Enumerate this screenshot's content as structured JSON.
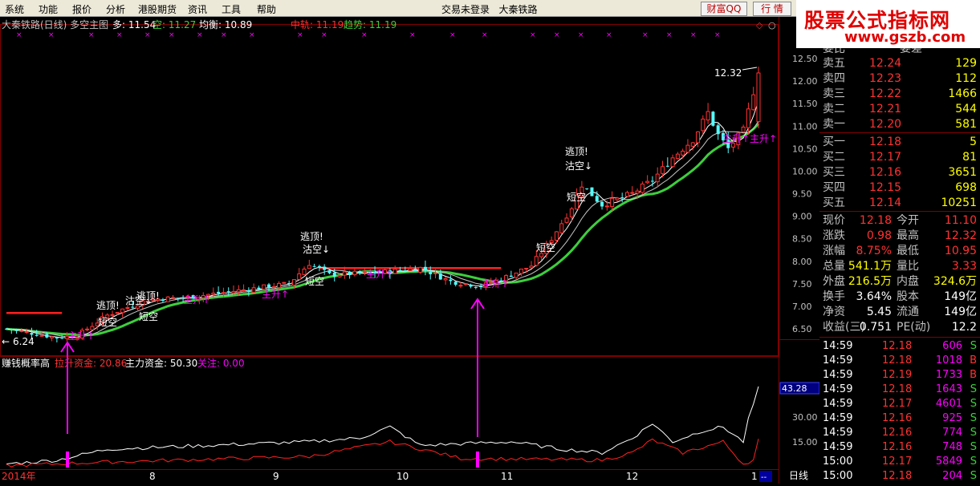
{
  "menu": [
    "系统",
    "功能",
    "报价",
    "分析",
    "港股期货",
    "资讯",
    "工具",
    "帮助"
  ],
  "center_text": [
    "交易未登录",
    "大秦铁路"
  ],
  "top_buttons": [
    "财富QQ",
    "行 情"
  ],
  "logo": {
    "main": "股票公式指标网",
    "sub": "www.gszb.com"
  },
  "info_bar": {
    "title": "大秦铁路(日线) 多空主图",
    "duo_label": "多: 11.54",
    "kong_label": "空: 11.27",
    "junheng_label": "均衡: 10.89",
    "zhonggui_label": "中轨: 11.19",
    "qushi_label": "趋势: 11.19"
  },
  "lower_info": {
    "name": "赚钱概率高",
    "lasheng": "拉升资金: 20.86",
    "zhuli": "主力资金: 50.30",
    "guanzhu": "关注: 0.00"
  },
  "colors": {
    "up": "#ff3232",
    "down": "#54fcfc",
    "green": "#3ccf3c",
    "magenta": "#ff00ff",
    "yellow": "#ffff00",
    "white": "#ffffff"
  },
  "price_axis": [
    "12.50",
    "12.00",
    "11.50",
    "11.00",
    "10.50",
    "10.00",
    "9.50",
    "9.00",
    "8.50",
    "8.00",
    "7.50",
    "7.00",
    "6.50"
  ],
  "lower_axis": {
    "current": "43.28",
    "ticks": [
      "30.00",
      "15.00"
    ]
  },
  "date_axis": [
    "2014年",
    "8",
    "9",
    "10",
    "11",
    "12",
    "1"
  ],
  "daily_label": "日线",
  "annotations": {
    "high": "12.32",
    "low": "6.24"
  },
  "signals": {
    "taoding": "逃顶!",
    "gukong": "沽空↓",
    "duankong": "短空",
    "zhusheng": "主升↑"
  },
  "quote": {
    "top_cut": [
      "委比",
      "委差"
    ],
    "sell": [
      {
        "label": "卖五",
        "price": "12.24",
        "vol": "129"
      },
      {
        "label": "卖四",
        "price": "12.23",
        "vol": "112"
      },
      {
        "label": "卖三",
        "price": "12.22",
        "vol": "1466"
      },
      {
        "label": "卖二",
        "price": "12.21",
        "vol": "544"
      },
      {
        "label": "卖一",
        "price": "12.20",
        "vol": "581"
      }
    ],
    "buy": [
      {
        "label": "买一",
        "price": "12.18",
        "vol": "5"
      },
      {
        "label": "买二",
        "price": "12.17",
        "vol": "81"
      },
      {
        "label": "买三",
        "price": "12.16",
        "vol": "3651"
      },
      {
        "label": "买四",
        "price": "12.15",
        "vol": "698"
      },
      {
        "label": "买五",
        "price": "12.14",
        "vol": "10251"
      }
    ],
    "stats": [
      {
        "l1": "现价",
        "v1": "12.18",
        "l2": "今开",
        "v2": "11.10"
      },
      {
        "l1": "涨跌",
        "v1": "0.98",
        "l2": "最高",
        "v2": "12.32"
      },
      {
        "l1": "涨幅",
        "v1": "8.75%",
        "l2": "最低",
        "v2": "10.95"
      },
      {
        "l1": "总量",
        "v1": "541.1万",
        "l2": "量比",
        "v2": "3.33"
      },
      {
        "l1": "外盘",
        "v1": "216.5万",
        "l2": "内盘",
        "v2": "324.6万"
      },
      {
        "l1": "换手",
        "v1": "3.64%",
        "l2": "股本",
        "v2": "149亿"
      },
      {
        "l1": "净资",
        "v1": "5.45",
        "l2": "流通",
        "v2": "149亿"
      },
      {
        "l1": "收益(三)",
        "v1": "0.751",
        "l2": "PE(动)",
        "v2": "12.2"
      }
    ],
    "ticks": [
      {
        "t": "14:59",
        "p": "12.18",
        "v": "606",
        "s": "S"
      },
      {
        "t": "14:59",
        "p": "12.18",
        "v": "1018",
        "s": "B"
      },
      {
        "t": "14:59",
        "p": "12.19",
        "v": "1733",
        "s": "B"
      },
      {
        "t": "14:59",
        "p": "12.18",
        "v": "1643",
        "s": "S"
      },
      {
        "t": "14:59",
        "p": "12.17",
        "v": "4601",
        "s": "S"
      },
      {
        "t": "14:59",
        "p": "12.16",
        "v": "925",
        "s": "S"
      },
      {
        "t": "14:59",
        "p": "12.16",
        "v": "774",
        "s": "S"
      },
      {
        "t": "14:59",
        "p": "12.16",
        "v": "748",
        "s": "S"
      },
      {
        "t": "15:00",
        "p": "12.17",
        "v": "5849",
        "s": "S"
      },
      {
        "t": "15:00",
        "p": "12.18",
        "v": "204",
        "s": "S"
      }
    ]
  }
}
